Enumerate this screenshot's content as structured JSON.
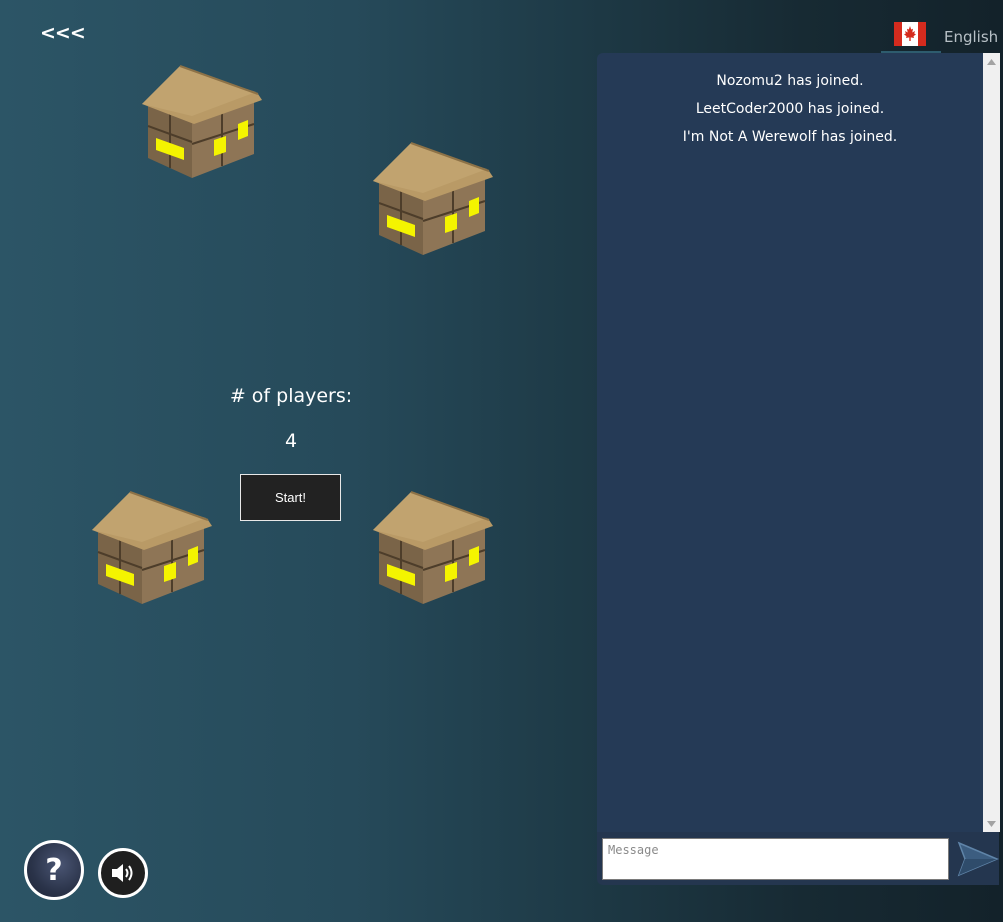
{
  "nav": {
    "back_label": "<<<"
  },
  "language": {
    "flag_icon": "canada-flag-icon",
    "label": "English"
  },
  "lobby": {
    "players_label": "# of players:",
    "players_count": "4",
    "start_label": "Start!"
  },
  "houses": [
    {
      "icon": "house-icon"
    },
    {
      "icon": "house-icon"
    },
    {
      "icon": "house-icon"
    },
    {
      "icon": "house-icon"
    }
  ],
  "chat": {
    "messages": [
      "Nozomu2 has joined.",
      "LeetCoder2000 has joined.",
      "I'm Not A Werewolf has joined."
    ],
    "input_placeholder": "Message",
    "send_icon": "send-arrow-icon"
  },
  "controls": {
    "help_label": "?",
    "help_icon": "help-icon",
    "sound_icon": "speaker-icon"
  },
  "colors": {
    "background_left": "#2c5566",
    "background_right": "#13222a",
    "chat_panel": "#253a56",
    "house_roof": "#b8965f",
    "house_window": "#ffff00"
  }
}
